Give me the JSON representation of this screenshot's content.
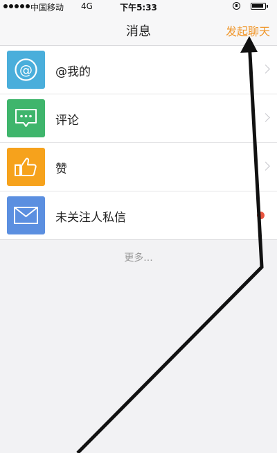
{
  "status_bar": {
    "carrier": "中国移动",
    "network": "4G",
    "time": "下午5:33"
  },
  "nav": {
    "title": "消息",
    "action": "发起聊天",
    "action_color": "#f0962a"
  },
  "list": {
    "items": [
      {
        "label": "@我的",
        "icon": "at-icon",
        "color": "#4aaedb"
      },
      {
        "label": "评论",
        "icon": "comment-icon",
        "color": "#3fb56c"
      },
      {
        "label": "赞",
        "icon": "thumbs-up-icon",
        "color": "#f6a21c"
      },
      {
        "label": "未关注人私信",
        "icon": "envelope-icon",
        "color": "#5b8fe0"
      }
    ]
  },
  "more_text": "更多..."
}
